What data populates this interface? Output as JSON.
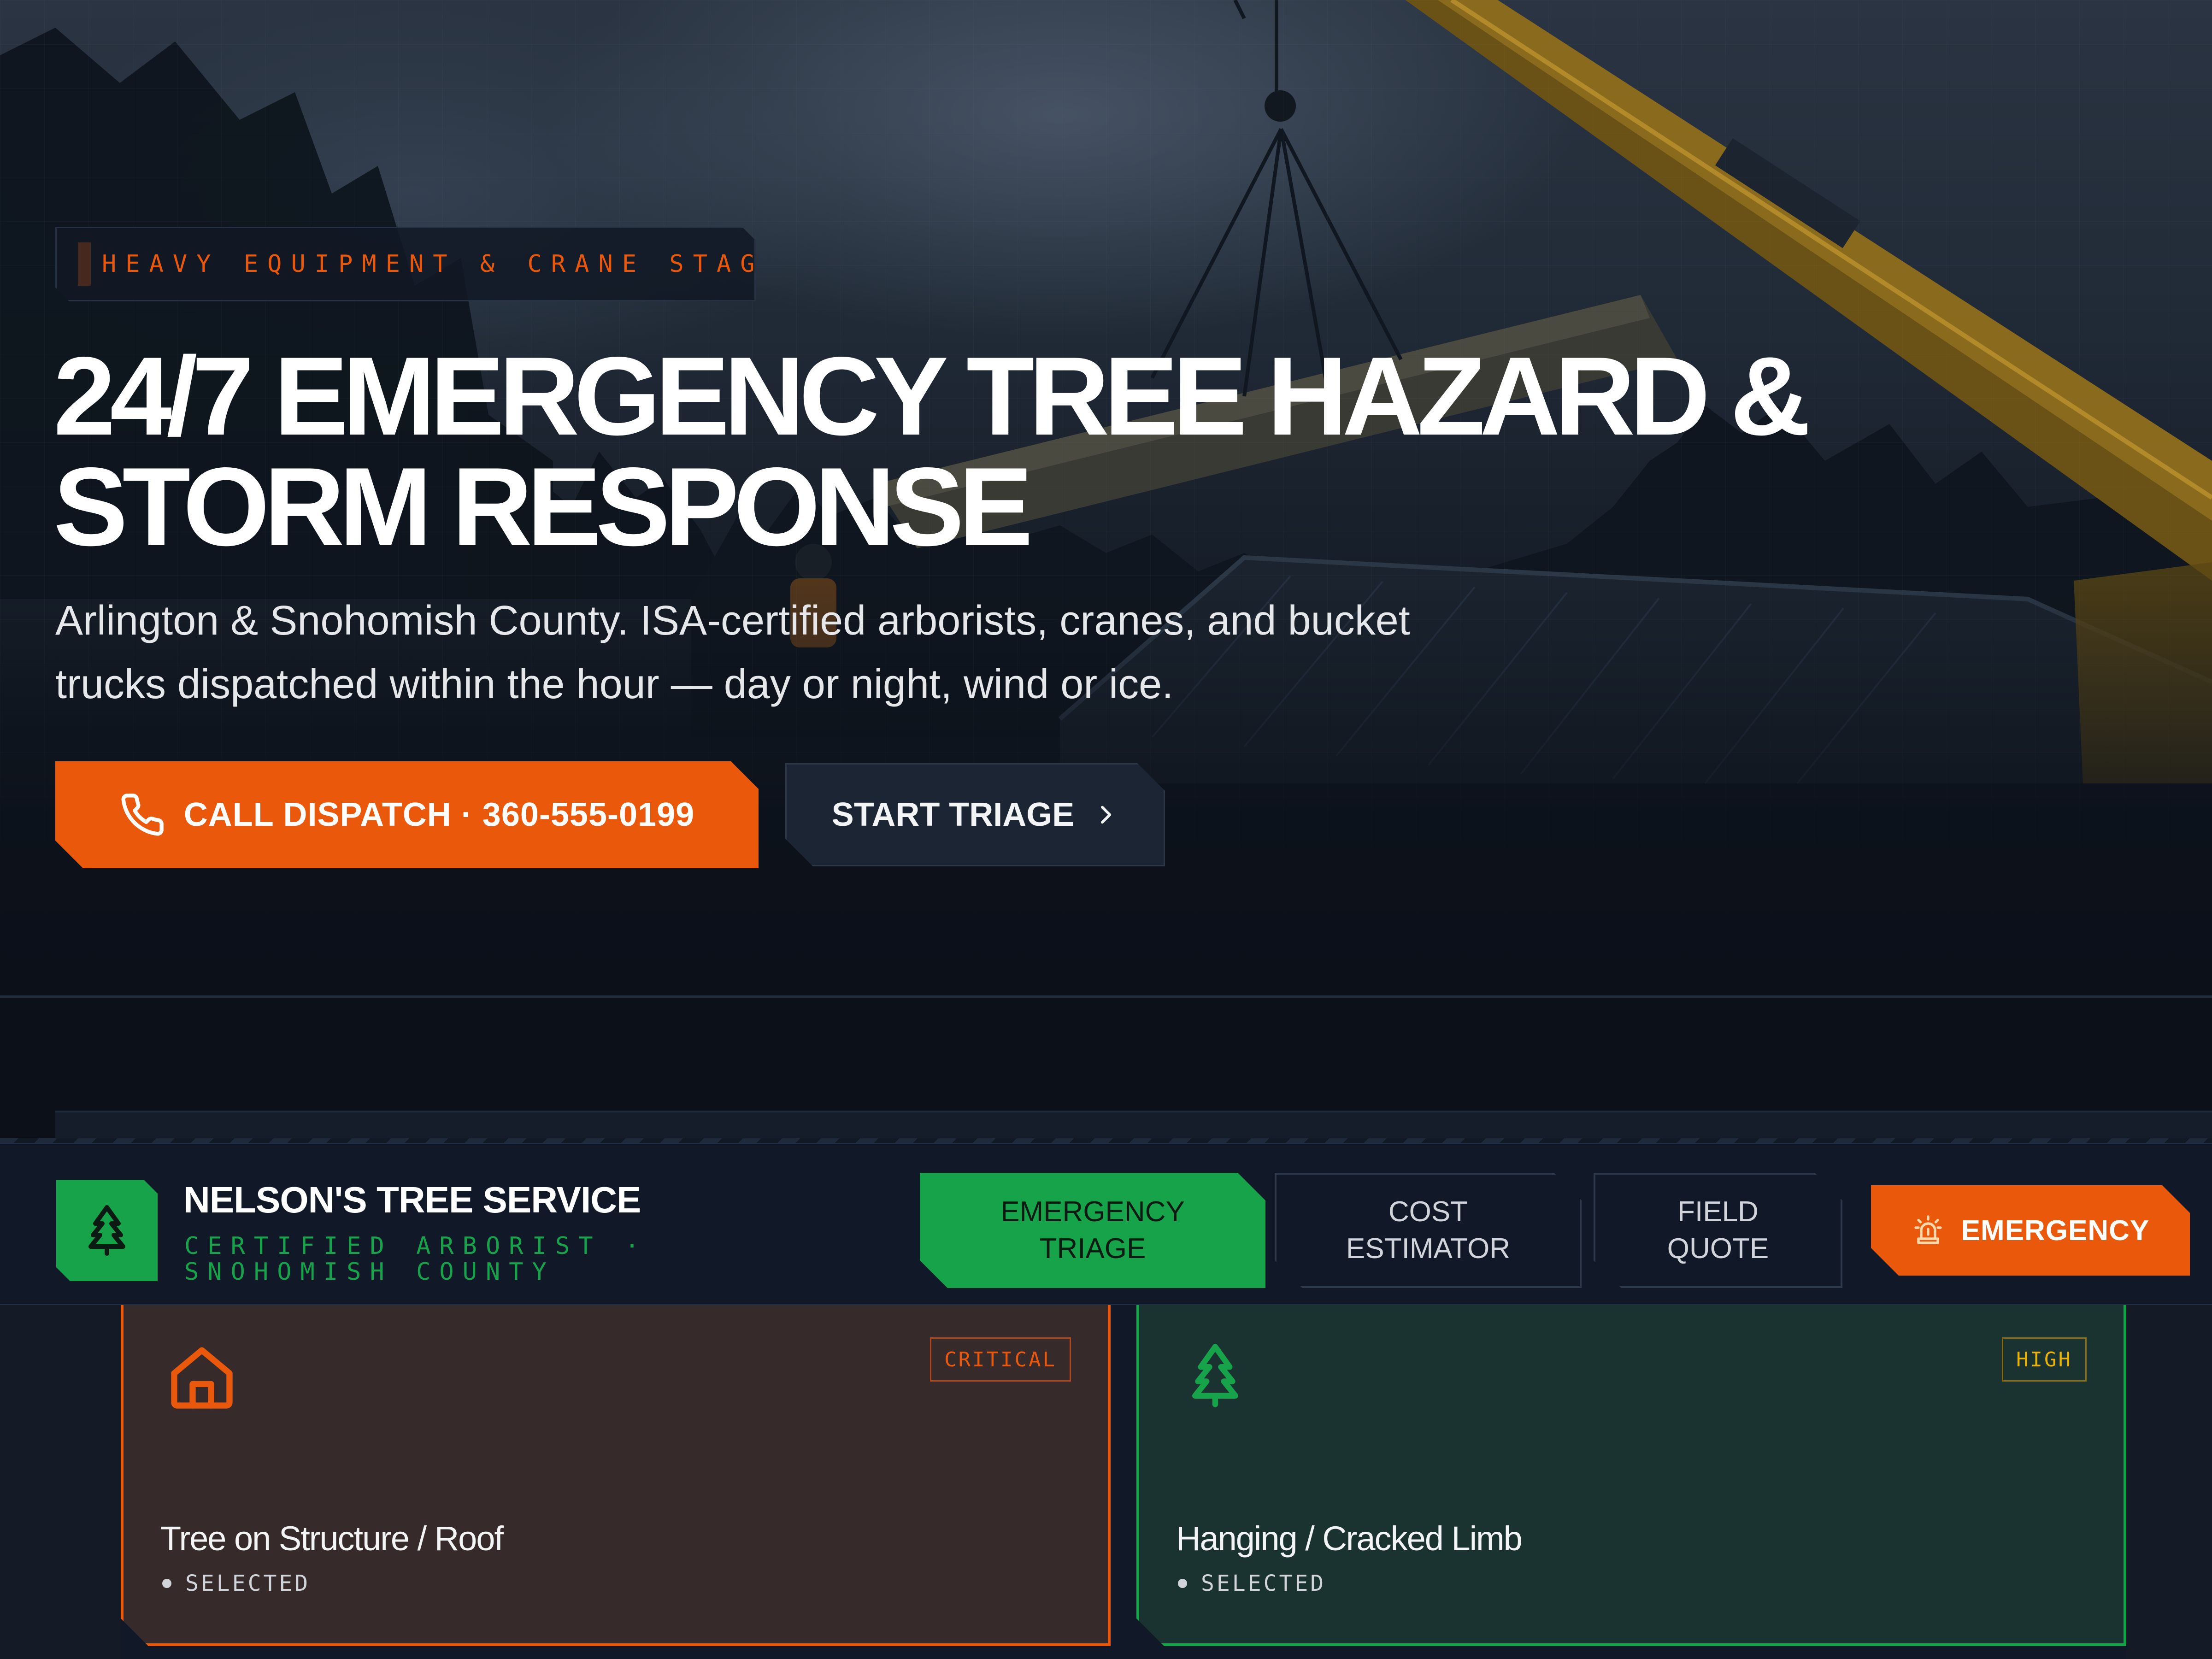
{
  "hero": {
    "badge": "HEAVY EQUIPMENT & CRANE STAGED",
    "title_line1": "24/7 EMERGENCY TREE HAZARD &",
    "title_line2": "STORM RESPONSE",
    "subtitle_line1": "Arlington & Snohomish County. ISA-certified arborists, cranes, and bucket",
    "subtitle_line2": "trucks dispatched within the hour — day or night, wind or ice.",
    "call_button": "CALL DISPATCH · 360-555-0199",
    "triage_button": "START TRIAGE"
  },
  "header": {
    "brand_name": "NELSON'S TREE SERVICE",
    "brand_sub": "CERTIFIED ARBORIST · SNOHOMISH COUNTY",
    "tabs": [
      {
        "label": "EMERGENCY\nTRIAGE",
        "active": true
      },
      {
        "label": "COST\nESTIMATOR",
        "active": false
      },
      {
        "label": "FIELD\nQUOTE",
        "active": false
      }
    ],
    "emergency_button": "EMERGENCY"
  },
  "cards": [
    {
      "title": "Tree on Structure / Roof",
      "severity": "CRITICAL",
      "status": "SELECTED",
      "icon": "house-icon"
    },
    {
      "title": "Hanging / Cracked Limb",
      "severity": "HIGH",
      "status": "SELECTED",
      "icon": "tree-icon"
    }
  ],
  "colors": {
    "accent_orange": "#ea580c",
    "accent_green": "#16a34a",
    "severity_high": "#eab308",
    "background": "#0b1019"
  }
}
